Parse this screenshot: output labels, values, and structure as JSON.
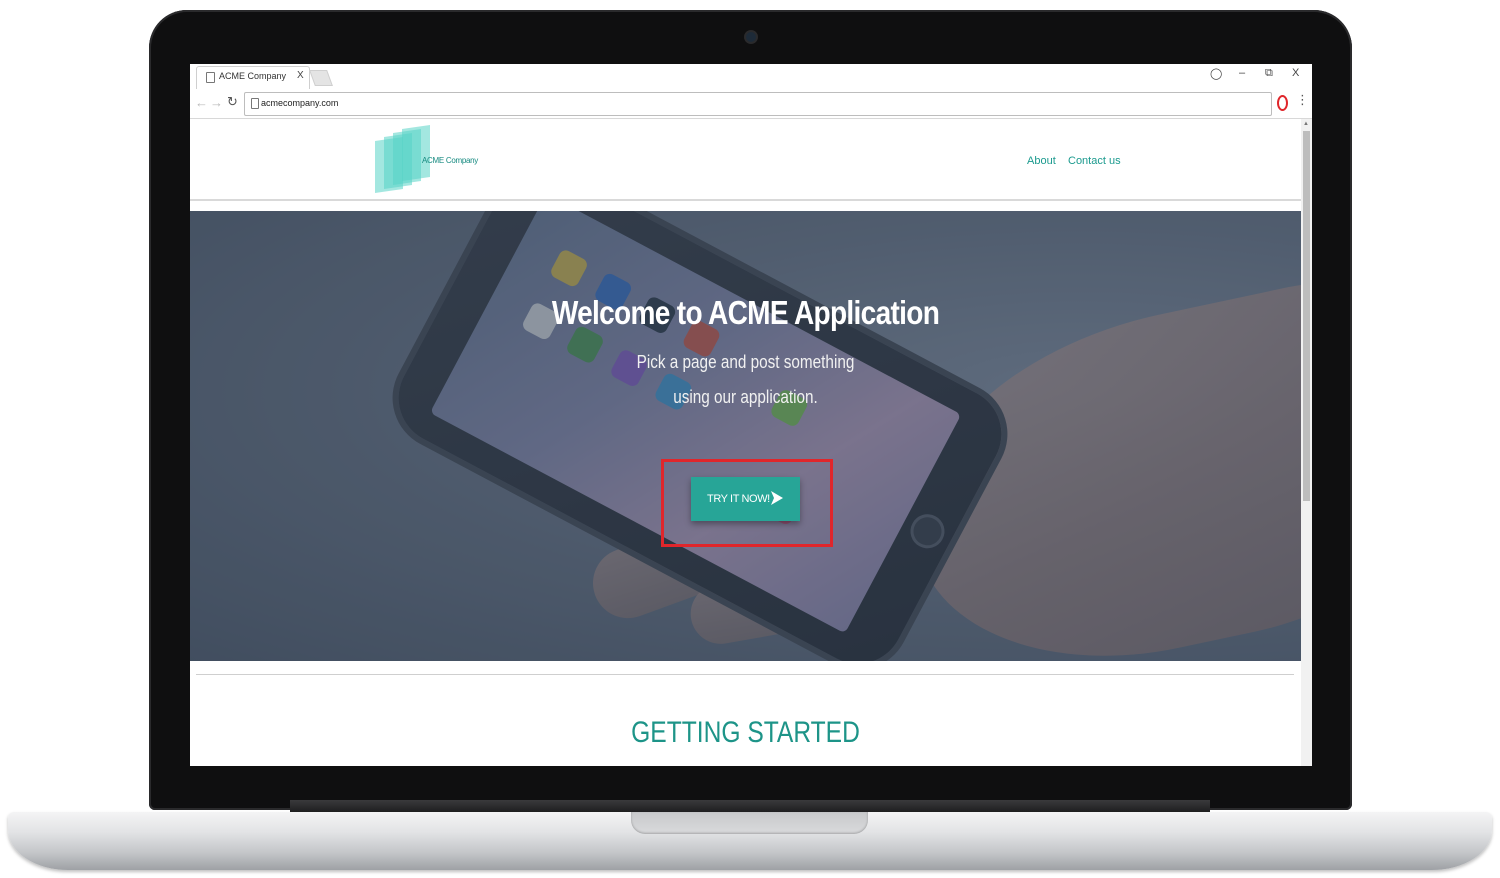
{
  "browser": {
    "tab_title": "ACME Company",
    "tab_close": "X",
    "url": "acmecompany.com",
    "window_controls": {
      "minimize": "–",
      "restore": "⧉",
      "close": "X"
    }
  },
  "site": {
    "logo_text": "ACME Company",
    "nav": [
      {
        "label": "About"
      },
      {
        "label": "Contact us"
      }
    ],
    "hero": {
      "title": "Welcome to ACME Application",
      "subtitle_line1": "Pick a page and post something",
      "subtitle_line2": "using our application.",
      "cta_label": "TRY IT NOW!",
      "cta_icon": "send-arrow-icon"
    },
    "section_title": "GETTING STARTED"
  },
  "colors": {
    "accent": "#27a597",
    "link": "#1b9a8e",
    "highlight": "#e0262b"
  }
}
